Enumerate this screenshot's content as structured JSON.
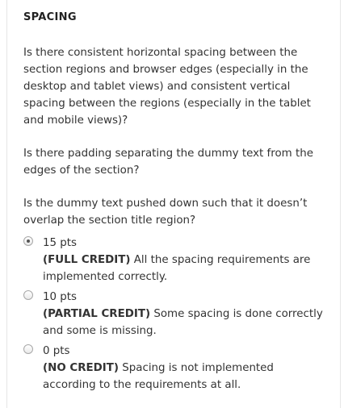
{
  "section": {
    "title": "SPACING"
  },
  "questions": [
    "Is there consistent horizontal spacing between the section regions and browser edges (especially in the desktop and tablet views) and consistent vertical spacing between the regions (especially in the tablet and mobile views)?",
    "Is there padding separating the dummy text from the edges of the section?",
    "Is the dummy text pushed down such that it doesn’t overlap the section title region?"
  ],
  "options": [
    {
      "points": "15 pts",
      "label": "(FULL CREDIT)",
      "text": " All the spacing requirements are implemented correctly.",
      "selected": true
    },
    {
      "points": "10 pts",
      "label": "(PARTIAL CREDIT)",
      "text": " Some spacing is done correctly and some is missing.",
      "selected": false
    },
    {
      "points": "0 pts",
      "label": "(NO CREDIT)",
      "text": " Spacing is not implemented according to the requirements at all.",
      "selected": false
    }
  ]
}
